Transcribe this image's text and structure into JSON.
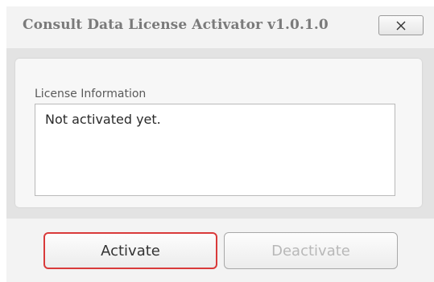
{
  "window": {
    "title": "Consult Data License Activator v1.0.1.0"
  },
  "close_button": {
    "icon": "close-x-icon"
  },
  "license_group": {
    "label": "License Information",
    "status_text": "Not activated yet."
  },
  "buttons": {
    "activate_label": "Activate",
    "deactivate_label": "Deactivate",
    "deactivate_enabled": false
  },
  "colors": {
    "focus_border": "#d93a3a",
    "disabled_text": "#b8b8b8"
  }
}
